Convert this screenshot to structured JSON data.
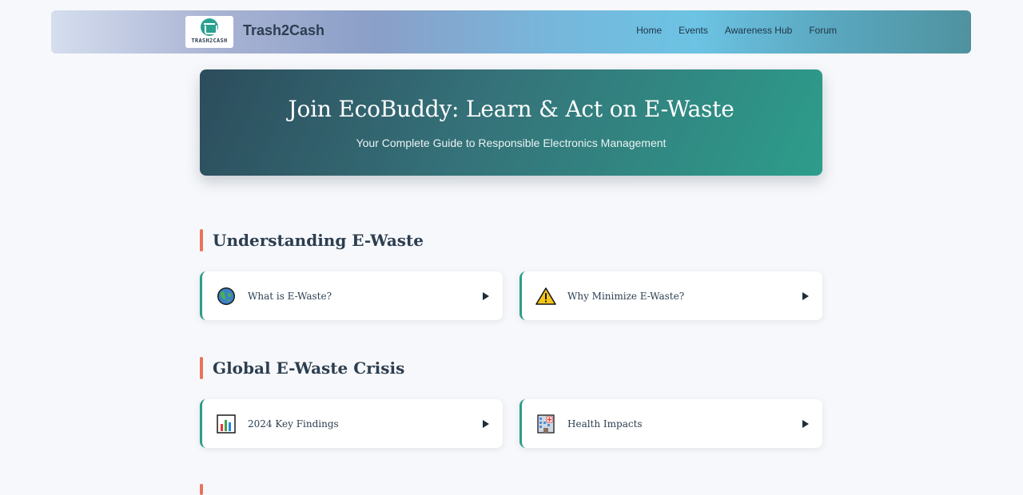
{
  "navbar": {
    "logo_text": "TRASH2CASH",
    "brand": "Trash2Cash",
    "links": [
      "Home",
      "Events",
      "Awareness Hub",
      "Forum"
    ]
  },
  "hero": {
    "title": "Join EcoBuddy: Learn & Act on E-Waste",
    "subtitle": "Your Complete Guide to Responsible Electronics Management"
  },
  "sections": [
    {
      "title": "Understanding E-Waste",
      "cards": [
        {
          "label": "What is E-Waste?",
          "icon": "globe-icon"
        },
        {
          "label": "Why Minimize E-Waste?",
          "icon": "warning-icon"
        }
      ]
    },
    {
      "title": "Global E-Waste Crisis",
      "cards": [
        {
          "label": "2024 Key Findings",
          "icon": "bar-chart-icon"
        },
        {
          "label": "Health Impacts",
          "icon": "hospital-icon"
        }
      ]
    }
  ],
  "colors": {
    "accent": "#e7735b",
    "teal": "#2d9d8b",
    "text": "#2c3e50"
  }
}
